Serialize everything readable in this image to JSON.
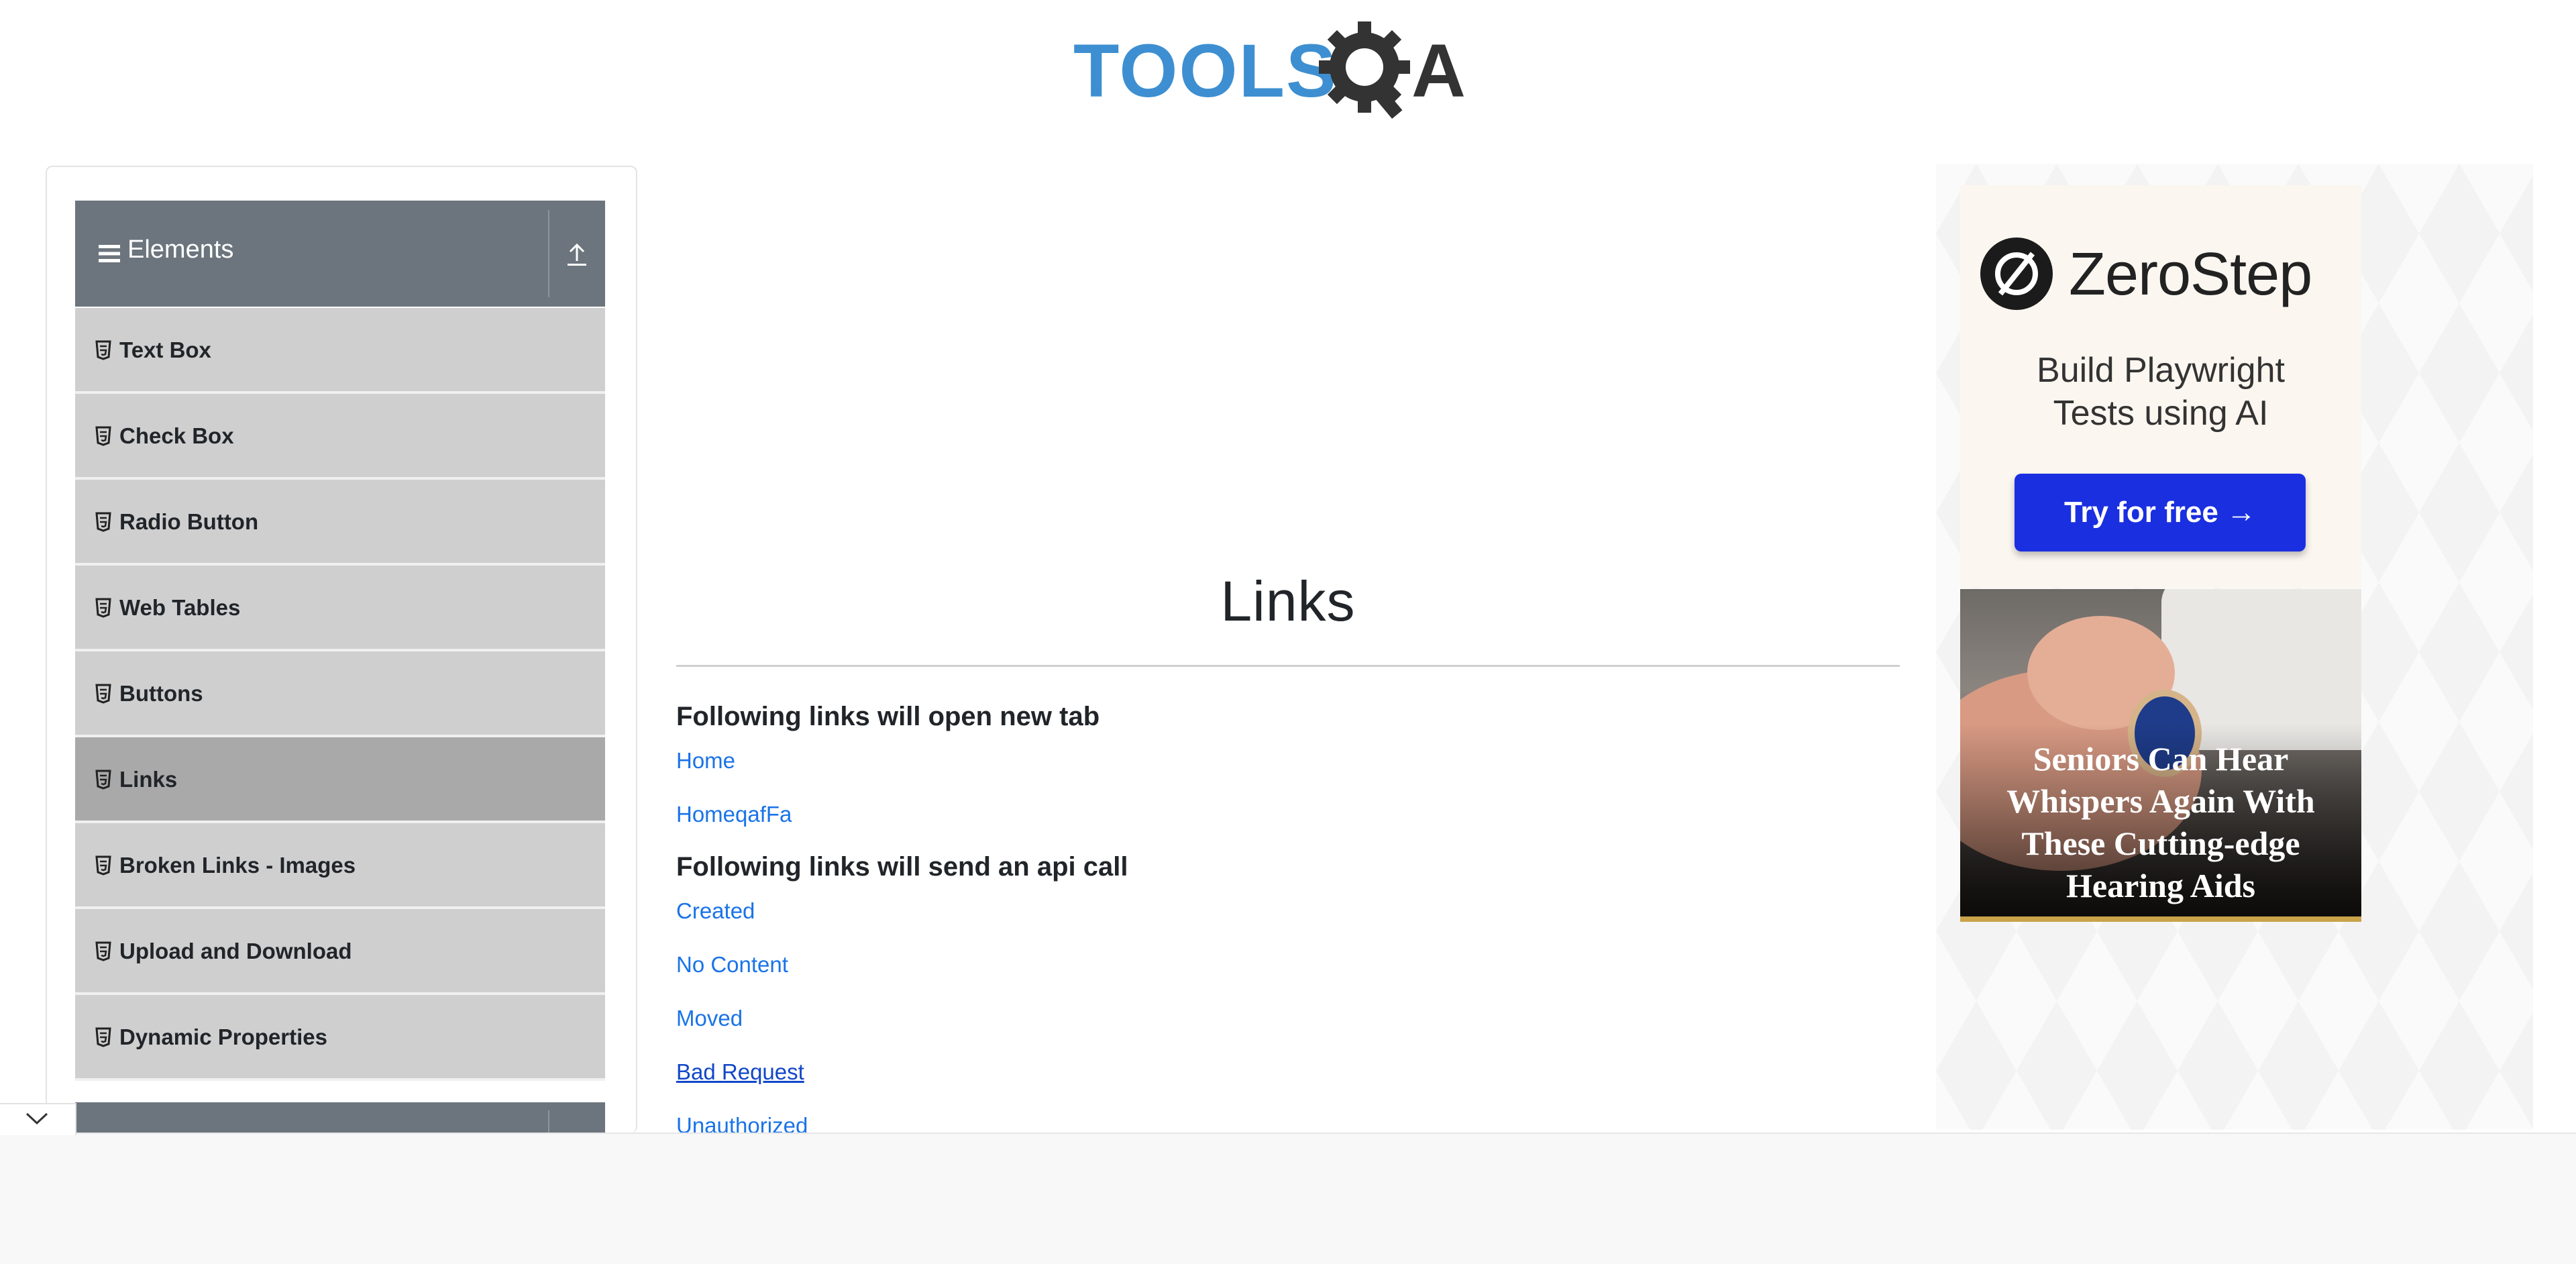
{
  "header": {
    "logo_text_left": "TOOLS",
    "logo_text_right": "A"
  },
  "sidebar": {
    "group_title": "Elements",
    "items": [
      {
        "label": "Text Box",
        "active": false
      },
      {
        "label": "Check Box",
        "active": false
      },
      {
        "label": "Radio Button",
        "active": false
      },
      {
        "label": "Web Tables",
        "active": false
      },
      {
        "label": "Buttons",
        "active": false
      },
      {
        "label": "Links",
        "active": true
      },
      {
        "label": "Broken Links - Images",
        "active": false
      },
      {
        "label": "Upload and Download",
        "active": false
      },
      {
        "label": "Dynamic Properties",
        "active": false
      }
    ]
  },
  "main": {
    "page_title": "Links",
    "section1_heading": "Following links will open new tab",
    "section1_links": [
      "Home",
      "HomeqafFa"
    ],
    "section2_heading": "Following links will send an api call",
    "section2_links": [
      "Created",
      "No Content",
      "Moved",
      "Bad Request",
      "Unauthorized"
    ]
  },
  "ad": {
    "brand": "ZeroStep",
    "tagline_line1": "Build Playwright",
    "tagline_line2": "Tests using AI",
    "cta": "Try for free →",
    "headline_line1": "Seniors Can Hear",
    "headline_line2": "Whispers Again With",
    "headline_line3": "These Cutting-edge",
    "headline_line4": "Hearing Aids"
  },
  "colors": {
    "logo_blue": "#3d8fd1",
    "logo_dark": "#333333",
    "sidebar_header": "#6c757d",
    "link_blue": "#1a73e8",
    "cta_blue": "#1a2fe0"
  }
}
